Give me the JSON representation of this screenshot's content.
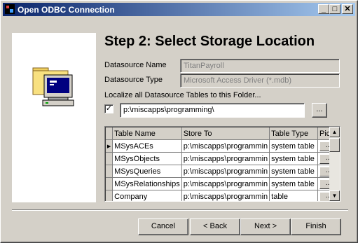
{
  "window": {
    "title": "Open ODBC Connection",
    "controls": {
      "minimize": "_",
      "maximize": "□",
      "close": "✕"
    }
  },
  "heading": "Step 2:  Select Storage Location",
  "datasource": {
    "name_label": "Datasource Name",
    "name_value": "TitanPayroll",
    "type_label": "Datasource Type",
    "type_value": "Microsoft Access Driver (*.mdb)"
  },
  "localize": {
    "label": "Localize all Datasource Tables to this Folder...",
    "checked": true,
    "check_glyph": "✓",
    "folder": "p:\\miscapps\\programming\\",
    "browse_label": "..."
  },
  "grid": {
    "columns": [
      "Table Name",
      "Store To",
      "Table Type",
      "Pick"
    ],
    "rows": [
      {
        "name": "MSysACEs",
        "store": "p:\\miscapps\\programmin",
        "type": "system table",
        "pick": "...",
        "current": true
      },
      {
        "name": "MSysObjects",
        "store": "p:\\miscapps\\programmin",
        "type": "system table",
        "pick": "..."
      },
      {
        "name": "MSysQueries",
        "store": "p:\\miscapps\\programmin",
        "type": "system table",
        "pick": "..."
      },
      {
        "name": "MSysRelationships",
        "store": "p:\\miscapps\\programmin",
        "type": "system table",
        "pick": "..."
      },
      {
        "name": "Company",
        "store": "p:\\miscapps\\programmin",
        "type": "table",
        "pick": "..."
      }
    ],
    "current_row_glyph": "▶",
    "scroll_up": "▲",
    "scroll_down": "▼"
  },
  "buttons": {
    "cancel": "Cancel",
    "back": "< Back",
    "next": "Next >",
    "finish": "Finish"
  },
  "colors": {
    "title_start": "#0a246a",
    "title_end": "#a6caf0",
    "face": "#d4d0c8"
  },
  "icons": {
    "wizard_image": "computer-with-folder-icon"
  }
}
